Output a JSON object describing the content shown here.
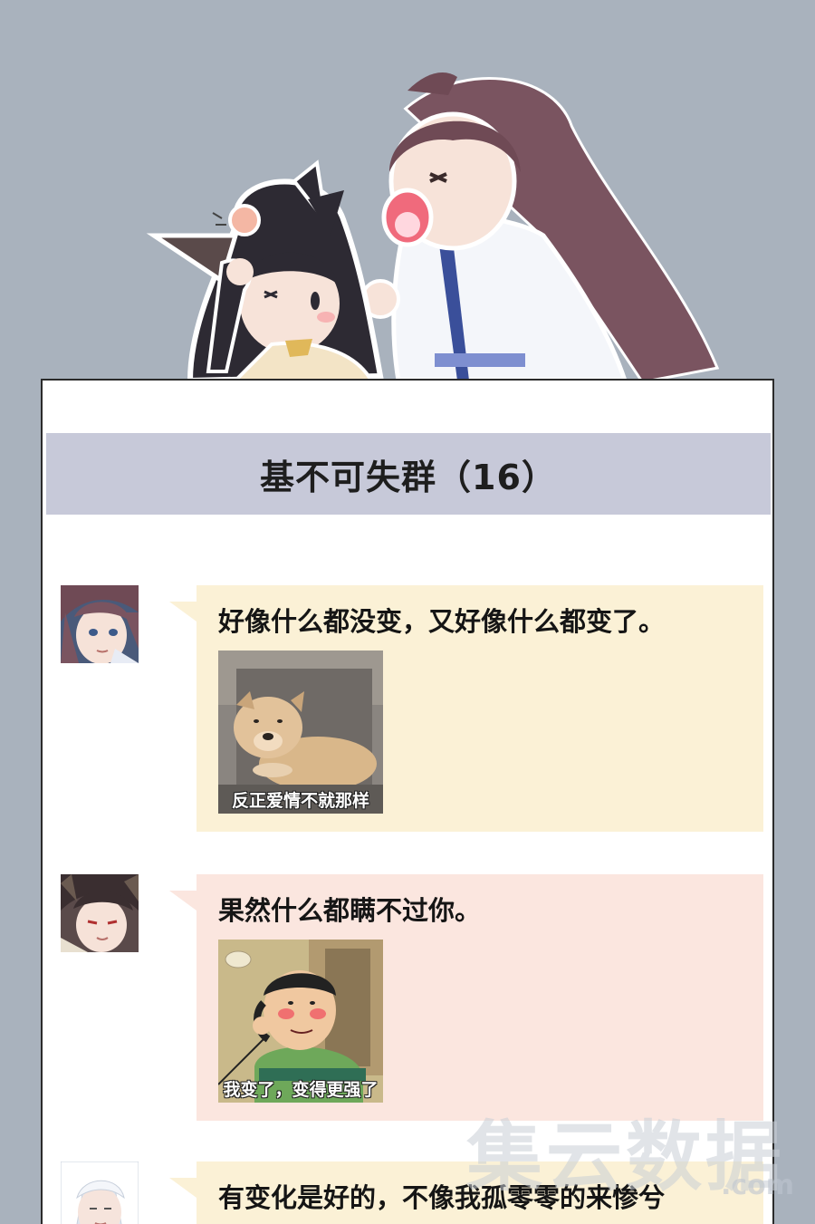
{
  "group_chat": {
    "title": "基不可失群（16）"
  },
  "messages": [
    {
      "text": "好像什么都没变，又好像什么都变了。",
      "bubble_color": "#fbf1d6",
      "sticker_caption": "反正爱情不就那样",
      "sticker_icon": "dog-sticker"
    },
    {
      "text": "果然什么都瞒不过你。",
      "bubble_color": "#fbe6df",
      "sticker_caption": "我变了，变得更强了",
      "sticker_icon": "phone-call-sticker"
    },
    {
      "text": "有变化是好的，不像我孤零零的来惨兮",
      "bubble_color": "#fbf1d6"
    }
  ],
  "watermark": {
    "main": "集云数据",
    "sub": ".com"
  },
  "colors": {
    "background": "#a9b2bd",
    "header_bar": "#c7c9d9",
    "window_border": "#2b2b2b"
  }
}
